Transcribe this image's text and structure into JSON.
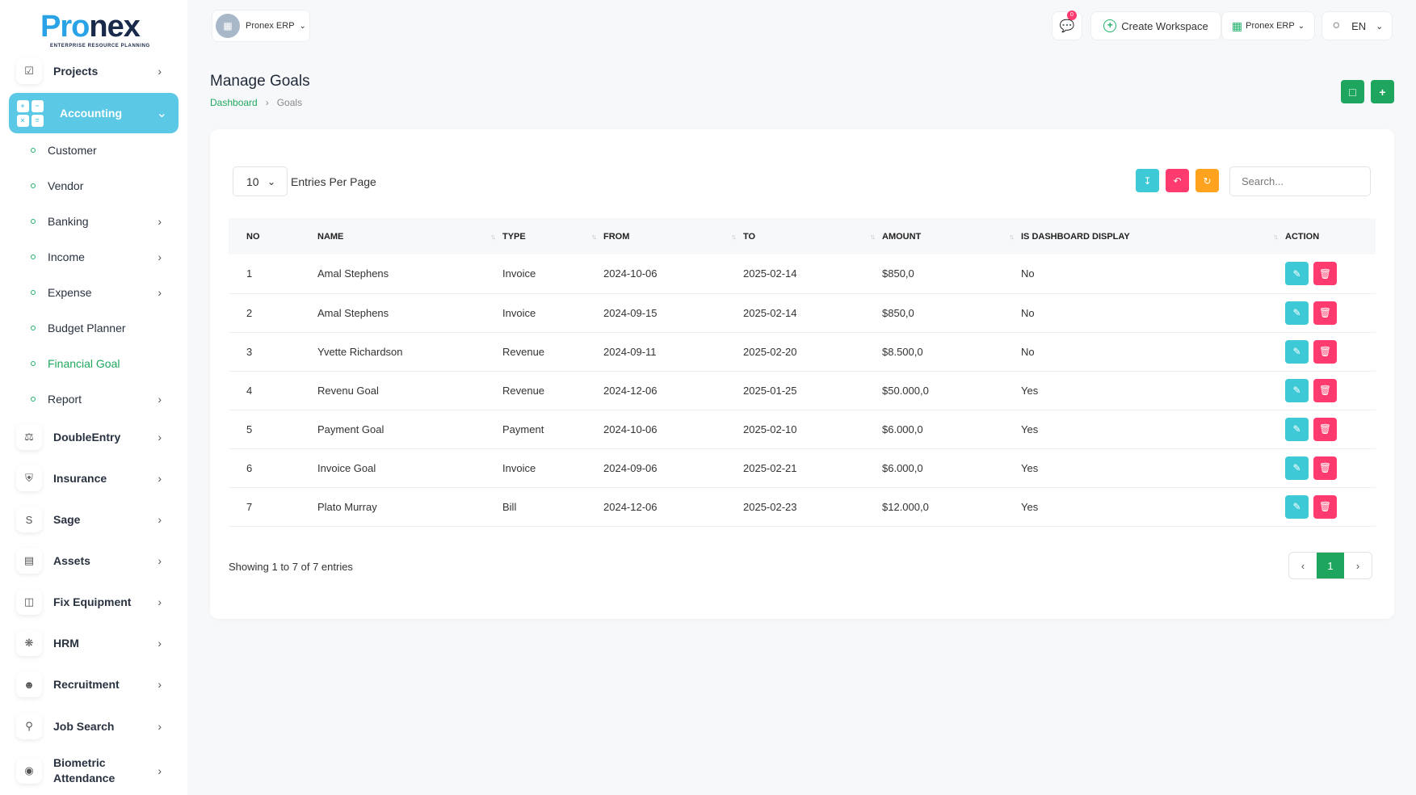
{
  "brand": {
    "logo_text": "Pronex",
    "tagline": "ENTERPRISE RESOURCE PLANNING"
  },
  "sidebar": {
    "top_items": [
      {
        "label": "Projects",
        "icon": "check-square-icon"
      }
    ],
    "active": {
      "label": "Accounting",
      "icon": "calculator-icon"
    },
    "sub_items": [
      {
        "label": "Customer"
      },
      {
        "label": "Vendor"
      },
      {
        "label": "Banking",
        "has_children": true
      },
      {
        "label": "Income",
        "has_children": true
      },
      {
        "label": "Expense",
        "has_children": true
      },
      {
        "label": "Budget Planner"
      },
      {
        "label": "Financial Goal",
        "active": true
      },
      {
        "label": "Report",
        "has_children": true
      }
    ],
    "items": [
      {
        "label": "DoubleEntry",
        "icon": "scale-icon"
      },
      {
        "label": "Insurance",
        "icon": "shield-icon"
      },
      {
        "label": "Sage",
        "icon": "letter-s-icon"
      },
      {
        "label": "Assets",
        "icon": "calculator-small-icon"
      },
      {
        "label": "Fix Equipment",
        "icon": "archive-icon"
      },
      {
        "label": "HRM",
        "icon": "network-icon"
      },
      {
        "label": "Recruitment",
        "icon": "user-plus-icon"
      },
      {
        "label": "Job Search",
        "icon": "file-search-icon"
      },
      {
        "label": "Biometric Attendance",
        "icon": "fingerprint-icon"
      }
    ]
  },
  "topbar": {
    "workspace": "Pronex ERP",
    "notifications_count": "0",
    "create_workspace": "Create Workspace",
    "erp_menu": "Pronex ERP",
    "language": "EN"
  },
  "page": {
    "title": "Manage Goals",
    "breadcrumb": {
      "home": "Dashboard",
      "current": "Goals"
    }
  },
  "table_controls": {
    "per_page": "10",
    "per_page_label": "Entries Per Page",
    "search_placeholder": "Search..."
  },
  "table": {
    "columns": [
      "NO",
      "NAME",
      "TYPE",
      "FROM",
      "TO",
      "AMOUNT",
      "IS DASHBOARD DISPLAY",
      "ACTION"
    ],
    "rows": [
      {
        "no": "1",
        "name": "Amal Stephens",
        "type": "Invoice",
        "from": "2024-10-06",
        "to": "2025-02-14",
        "amount": "$850,0",
        "display": "No"
      },
      {
        "no": "2",
        "name": "Amal Stephens",
        "type": "Invoice",
        "from": "2024-09-15",
        "to": "2025-02-14",
        "amount": "$850,0",
        "display": "No"
      },
      {
        "no": "3",
        "name": "Yvette Richardson",
        "type": "Revenue",
        "from": "2024-09-11",
        "to": "2025-02-20",
        "amount": "$8.500,0",
        "display": "No"
      },
      {
        "no": "4",
        "name": "Revenu Goal",
        "type": "Revenue",
        "from": "2024-12-06",
        "to": "2025-01-25",
        "amount": "$50.000,0",
        "display": "Yes"
      },
      {
        "no": "5",
        "name": "Payment Goal",
        "type": "Payment",
        "from": "2024-10-06",
        "to": "2025-02-10",
        "amount": "$6.000,0",
        "display": "Yes"
      },
      {
        "no": "6",
        "name": "Invoice Goal",
        "type": "Invoice",
        "from": "2024-09-06",
        "to": "2025-02-21",
        "amount": "$6.000,0",
        "display": "Yes"
      },
      {
        "no": "7",
        "name": "Plato Murray",
        "type": "Bill",
        "from": "2024-12-06",
        "to": "2025-02-23",
        "amount": "$12.000,0",
        "display": "Yes"
      }
    ]
  },
  "footer": {
    "showing": "Showing 1 to 7 of 7 entries",
    "current_page": "1"
  },
  "colors": {
    "primary": "#1ea65e",
    "accent": "#5bc8e6",
    "edit": "#3ec9d6",
    "danger": "#ff3a6e",
    "warning": "#ffa21d"
  }
}
